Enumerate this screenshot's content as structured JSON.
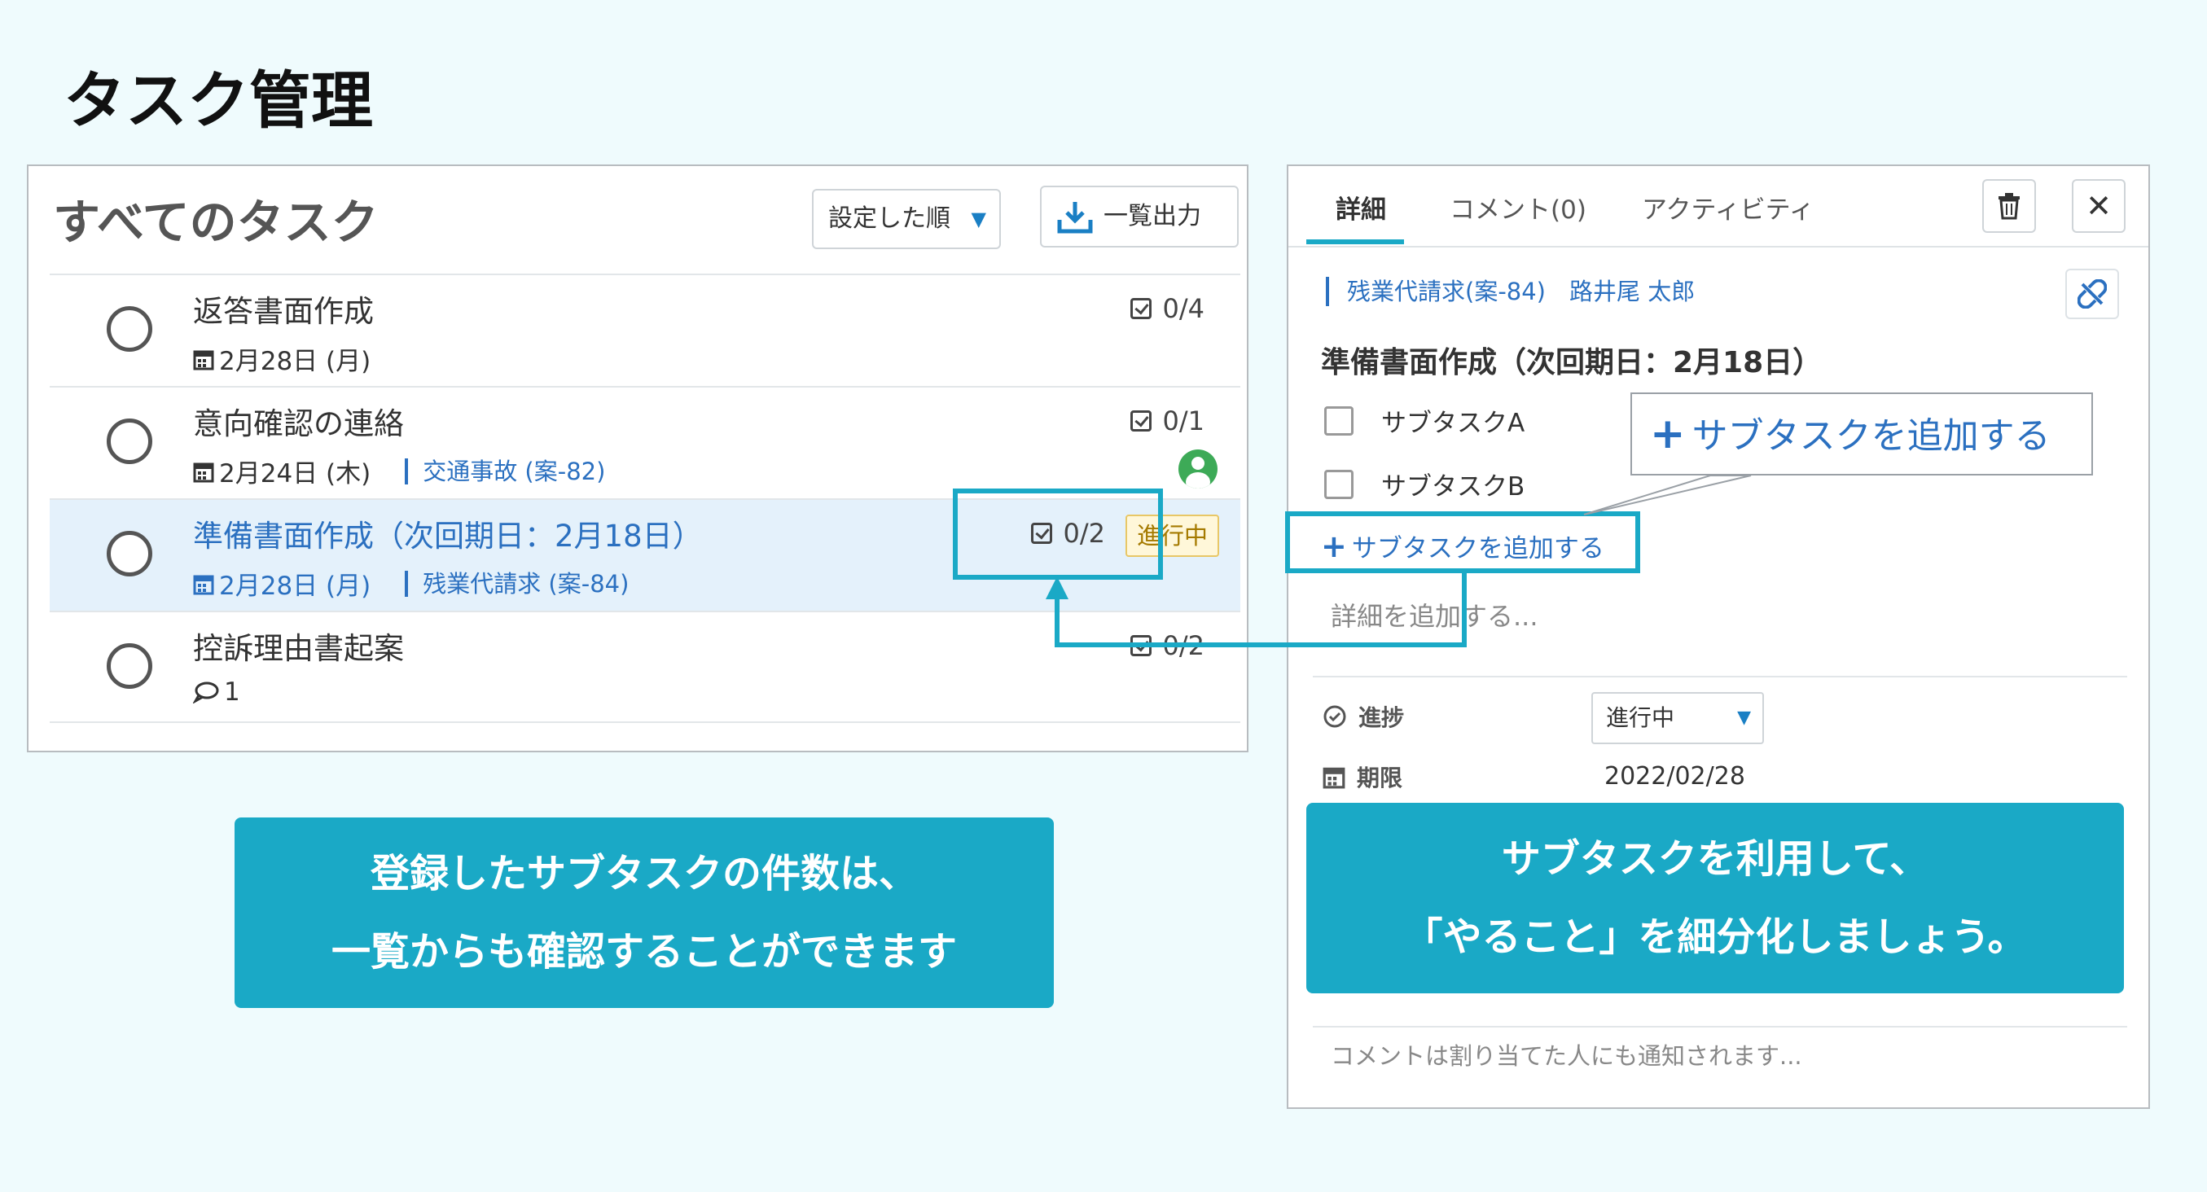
{
  "page_title": "タスク管理",
  "task_list": {
    "title": "すべてのタスク",
    "sort_label": "設定した順",
    "export_label": "一覧出力",
    "tasks": [
      {
        "name": "返答書面作成",
        "date": "2月28日 (月)",
        "case": "",
        "count": "0/4"
      },
      {
        "name": "意向確認の連絡",
        "date": "2月24日 (木)",
        "case": "交通事故 (案-82)",
        "count": "0/1"
      },
      {
        "name": "準備書面作成（次回期日：2月18日）",
        "date": "2月28日 (月)",
        "case": "残業代請求 (案-84)",
        "count": "0/2",
        "status": "進行中"
      },
      {
        "name": "控訴理由書起案",
        "comment_count": "1",
        "count": "0/2"
      }
    ]
  },
  "detail_panel": {
    "tabs": [
      "詳細",
      "コメント(0)",
      "アクティビティ"
    ],
    "breadcrumb": "残業代請求(案-84)　路井尾 太郎",
    "task_title": "準備書面作成（次回期日：2月18日）",
    "subtasks": [
      "サブタスクA",
      "サブタスクB"
    ],
    "add_subtask_label": "サブタスクを追加する",
    "details_placeholder": "詳細を追加する...",
    "progress_label": "進捗",
    "progress_value": "進行中",
    "due_label": "期限",
    "due_value": "2022/02/28",
    "comment_placeholder": "コメントは割り当てた人にも通知されます..."
  },
  "callouts": {
    "zoom_label": "サブタスクを追加する",
    "left_line1": "登録したサブタスクの件数は、",
    "left_line2": "一覧からも確認することができます",
    "right_line1": "サブタスクを利用して、",
    "right_line2": "「やること」を細分化しましょう。"
  },
  "colors": {
    "accent": "#1aa9c6",
    "link": "#2b70c0",
    "background": "#effbfd"
  }
}
